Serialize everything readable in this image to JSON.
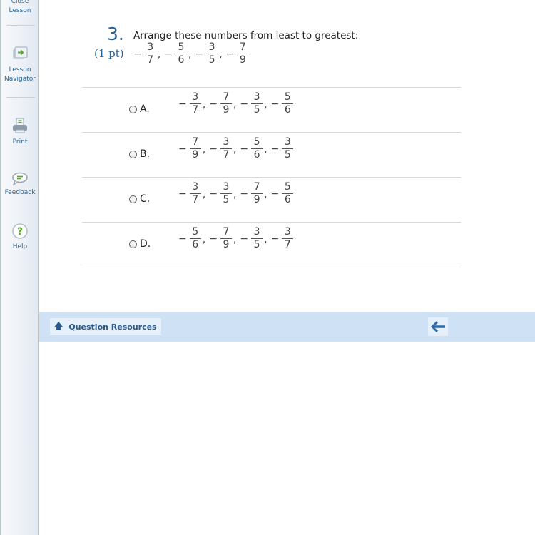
{
  "sidebar": {
    "items": [
      {
        "label_line1": "Close",
        "label_line2": "Lesson",
        "icon": "close-lesson-icon"
      },
      {
        "label_line1": "Lesson",
        "label_line2": "Navigator",
        "icon": "lesson-navigator-icon"
      },
      {
        "label_line1": "Print",
        "icon": "print-icon"
      },
      {
        "label_line1": "Feedback",
        "icon": "feedback-icon"
      },
      {
        "label_line1": "Help",
        "icon": "help-icon"
      }
    ]
  },
  "question": {
    "number": "3.",
    "points": "(1 pt)",
    "text": "Arrange these numbers from least to greatest:",
    "numbers": [
      {
        "sign": "−",
        "num": "3",
        "den": "7"
      },
      {
        "sign": "−",
        "num": "5",
        "den": "6"
      },
      {
        "sign": "−",
        "num": "3",
        "den": "5"
      },
      {
        "sign": "−",
        "num": "7",
        "den": "9"
      }
    ]
  },
  "options": [
    {
      "label": "A.",
      "selected": false,
      "fractions": [
        {
          "sign": "−",
          "num": "3",
          "den": "7"
        },
        {
          "sign": "−",
          "num": "7",
          "den": "9"
        },
        {
          "sign": "−",
          "num": "3",
          "den": "5"
        },
        {
          "sign": "−",
          "num": "5",
          "den": "6"
        }
      ]
    },
    {
      "label": "B.",
      "selected": false,
      "fractions": [
        {
          "sign": "−",
          "num": "7",
          "den": "9"
        },
        {
          "sign": "−",
          "num": "3",
          "den": "7"
        },
        {
          "sign": "−",
          "num": "5",
          "den": "6"
        },
        {
          "sign": "−",
          "num": "3",
          "den": "5"
        }
      ]
    },
    {
      "label": "C.",
      "selected": false,
      "fractions": [
        {
          "sign": "−",
          "num": "3",
          "den": "7"
        },
        {
          "sign": "−",
          "num": "3",
          "den": "5"
        },
        {
          "sign": "−",
          "num": "7",
          "den": "9"
        },
        {
          "sign": "−",
          "num": "5",
          "den": "6"
        }
      ]
    },
    {
      "label": "D.",
      "selected": false,
      "fractions": [
        {
          "sign": "−",
          "num": "5",
          "den": "6"
        },
        {
          "sign": "−",
          "num": "7",
          "den": "9"
        },
        {
          "sign": "−",
          "num": "3",
          "den": "5"
        },
        {
          "sign": "−",
          "num": "3",
          "den": "7"
        }
      ]
    }
  ],
  "footer": {
    "question_resources_label": "Question Resources",
    "back_icon": "arrow-left-icon"
  },
  "colors": {
    "accent": "#2a6496",
    "footer_bg": "#cfe2f5"
  }
}
